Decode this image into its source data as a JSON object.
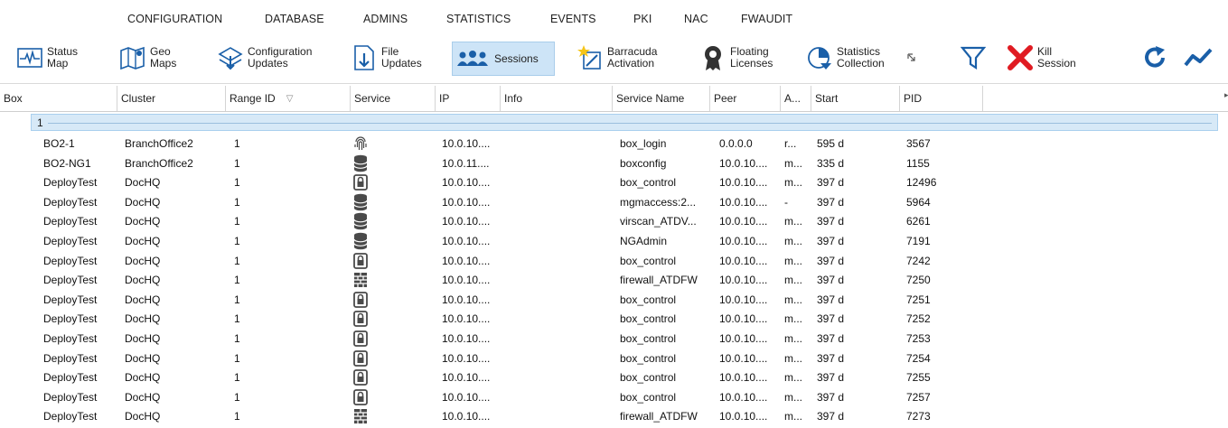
{
  "menu": [
    "CONFIGURATION",
    "DATABASE",
    "ADMINS",
    "STATISTICS",
    "EVENTS",
    "PKI",
    "NAC",
    "FWAUDIT"
  ],
  "ribbon": {
    "status_map": [
      "Status",
      "Map"
    ],
    "geo_maps": [
      "Geo",
      "Maps"
    ],
    "config_updates": [
      "Configuration",
      "Updates"
    ],
    "file_updates": [
      "File",
      "Updates"
    ],
    "sessions": "Sessions",
    "barracuda_activation": [
      "Barracuda",
      "Activation"
    ],
    "floating_licenses": [
      "Floating",
      "Licenses"
    ],
    "statistics_collection": [
      "Statistics",
      "Collection"
    ],
    "kill_session": [
      "Kill",
      "Session"
    ]
  },
  "columns": [
    "Box",
    "Cluster",
    "Range ID",
    "Service",
    "IP",
    "Info",
    "Service Name",
    "Peer",
    "A...",
    "Start",
    "PID"
  ],
  "group": {
    "label": "1"
  },
  "rows": [
    {
      "box": "BO2-1",
      "cluster": "BranchOffice2",
      "range": "1",
      "service": "fingerprint",
      "ip": "10.0.10....",
      "info": "",
      "service_name": "box_login",
      "peer": "0.0.0.0",
      "a": "r...",
      "start": "595 d",
      "pid": "3567"
    },
    {
      "box": "BO2-NG1",
      "cluster": "BranchOffice2",
      "range": "1",
      "service": "database",
      "ip": "10.0.11....",
      "info": "",
      "service_name": "boxconfig",
      "peer": "10.0.10....",
      "a": "m...",
      "start": "335 d",
      "pid": "1155"
    },
    {
      "box": "DeployTest",
      "cluster": "DocHQ",
      "range": "1",
      "service": "lock",
      "ip": "10.0.10....",
      "info": "",
      "service_name": "box_control",
      "peer": "10.0.10....",
      "a": "m...",
      "start": "397 d",
      "pid": "12496"
    },
    {
      "box": "DeployTest",
      "cluster": "DocHQ",
      "range": "1",
      "service": "database",
      "ip": "10.0.10....",
      "info": "",
      "service_name": "mgmaccess:2...",
      "peer": "10.0.10....",
      "a": "-",
      "start": "397 d",
      "pid": "5964"
    },
    {
      "box": "DeployTest",
      "cluster": "DocHQ",
      "range": "1",
      "service": "database",
      "ip": "10.0.10....",
      "info": "",
      "service_name": "virscan_ATDV...",
      "peer": "10.0.10....",
      "a": "m...",
      "start": "397 d",
      "pid": "6261"
    },
    {
      "box": "DeployTest",
      "cluster": "DocHQ",
      "range": "1",
      "service": "database",
      "ip": "10.0.10....",
      "info": "",
      "service_name": "NGAdmin",
      "peer": "10.0.10....",
      "a": "m...",
      "start": "397 d",
      "pid": "7191"
    },
    {
      "box": "DeployTest",
      "cluster": "DocHQ",
      "range": "1",
      "service": "lock",
      "ip": "10.0.10....",
      "info": "",
      "service_name": "box_control",
      "peer": "10.0.10....",
      "a": "m...",
      "start": "397 d",
      "pid": "7242"
    },
    {
      "box": "DeployTest",
      "cluster": "DocHQ",
      "range": "1",
      "service": "firewall",
      "ip": "10.0.10....",
      "info": "",
      "service_name": "firewall_ATDFW",
      "peer": "10.0.10....",
      "a": "m...",
      "start": "397 d",
      "pid": "7250"
    },
    {
      "box": "DeployTest",
      "cluster": "DocHQ",
      "range": "1",
      "service": "lock",
      "ip": "10.0.10....",
      "info": "",
      "service_name": "box_control",
      "peer": "10.0.10....",
      "a": "m...",
      "start": "397 d",
      "pid": "7251"
    },
    {
      "box": "DeployTest",
      "cluster": "DocHQ",
      "range": "1",
      "service": "lock",
      "ip": "10.0.10....",
      "info": "",
      "service_name": "box_control",
      "peer": "10.0.10....",
      "a": "m...",
      "start": "397 d",
      "pid": "7252"
    },
    {
      "box": "DeployTest",
      "cluster": "DocHQ",
      "range": "1",
      "service": "lock",
      "ip": "10.0.10....",
      "info": "",
      "service_name": "box_control",
      "peer": "10.0.10....",
      "a": "m...",
      "start": "397 d",
      "pid": "7253"
    },
    {
      "box": "DeployTest",
      "cluster": "DocHQ",
      "range": "1",
      "service": "lock",
      "ip": "10.0.10....",
      "info": "",
      "service_name": "box_control",
      "peer": "10.0.10....",
      "a": "m...",
      "start": "397 d",
      "pid": "7254"
    },
    {
      "box": "DeployTest",
      "cluster": "DocHQ",
      "range": "1",
      "service": "lock",
      "ip": "10.0.10....",
      "info": "",
      "service_name": "box_control",
      "peer": "10.0.10....",
      "a": "m...",
      "start": "397 d",
      "pid": "7255"
    },
    {
      "box": "DeployTest",
      "cluster": "DocHQ",
      "range": "1",
      "service": "lock",
      "ip": "10.0.10....",
      "info": "",
      "service_name": "box_control",
      "peer": "10.0.10....",
      "a": "m...",
      "start": "397 d",
      "pid": "7257"
    },
    {
      "box": "DeployTest",
      "cluster": "DocHQ",
      "range": "1",
      "service": "firewall",
      "ip": "10.0.10....",
      "info": "",
      "service_name": "firewall_ATDFW",
      "peer": "10.0.10....",
      "a": "m...",
      "start": "397 d",
      "pid": "7273"
    }
  ],
  "colors": {
    "accent": "#1a5fa8",
    "selected_bg": "#cde4f7",
    "group_bg": "#d7e9f7",
    "kill_red": "#e01b22"
  }
}
